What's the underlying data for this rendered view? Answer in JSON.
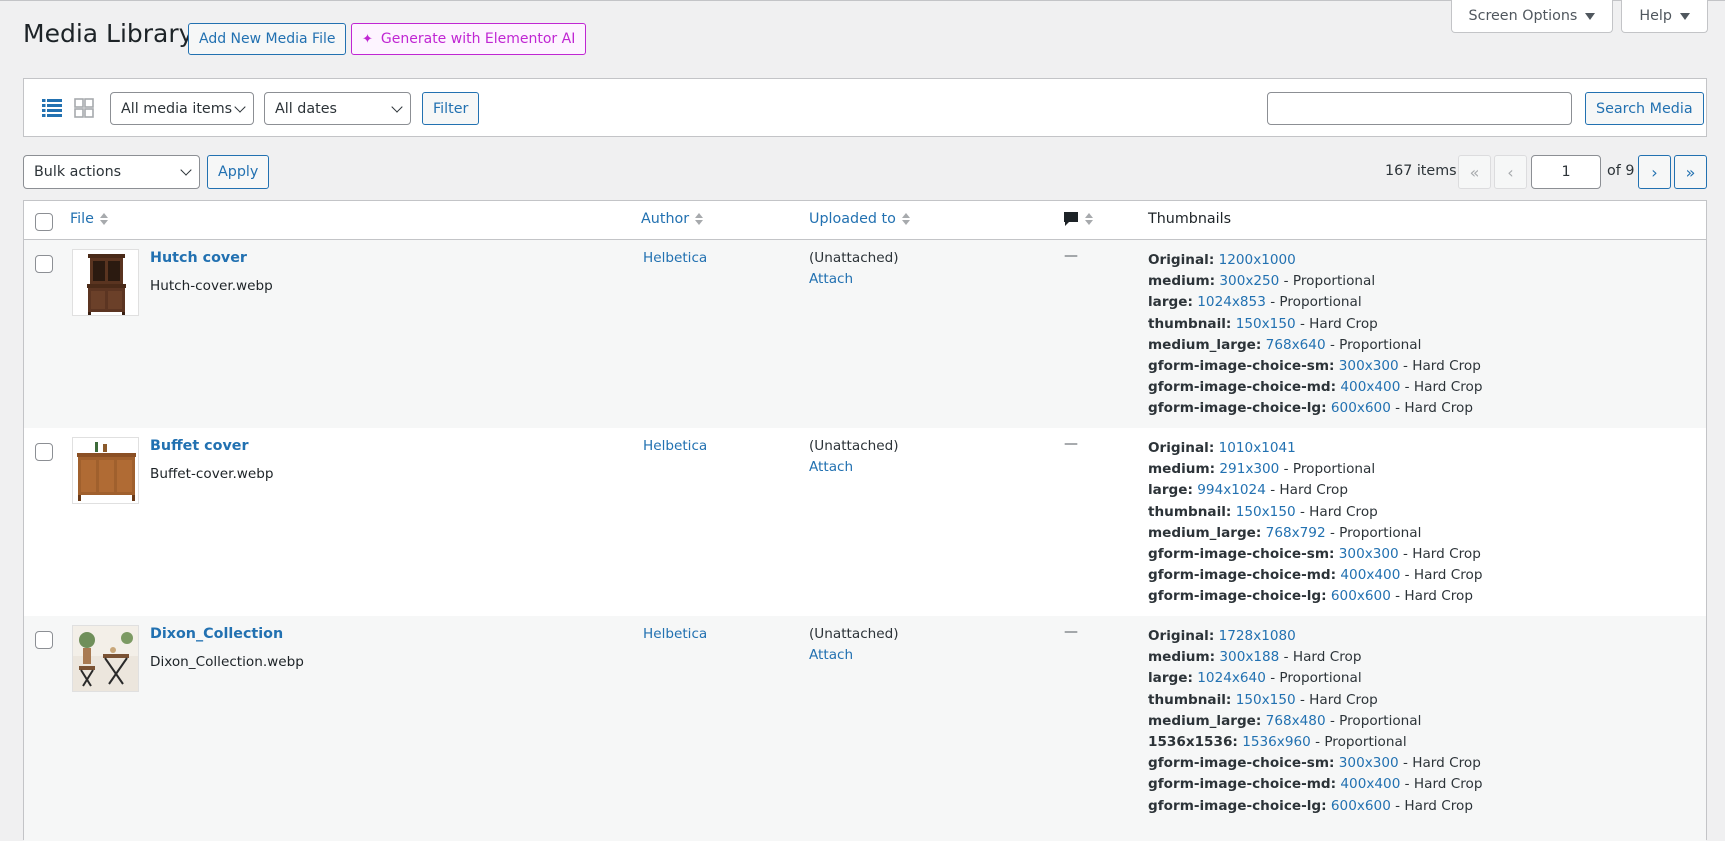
{
  "header": {
    "title": "Media Library",
    "add_new": "Add New Media File",
    "ai_button": "Generate with Elementor AI",
    "screen_options": "Screen Options",
    "help": "Help"
  },
  "filters": {
    "media_type": "All media items",
    "dates": "All dates",
    "filter_button": "Filter",
    "search_placeholder": "",
    "search_button": "Search Media"
  },
  "bulk": {
    "label": "Bulk actions",
    "apply": "Apply"
  },
  "pagination": {
    "items_count": "167 items",
    "first": "«",
    "prev": "‹",
    "current_page": "1",
    "of_text": "of 9",
    "next": "›",
    "last": "»"
  },
  "table": {
    "columns": {
      "file": "File",
      "author": "Author",
      "uploaded_to": "Uploaded to",
      "thumbnails": "Thumbnails"
    },
    "rows": [
      {
        "title": "Hutch cover",
        "filename": "Hutch-cover.webp",
        "author": "Helbetica",
        "uploaded_to": "(Unattached)",
        "attach": "Attach",
        "comments": "—",
        "thumbnails": [
          {
            "name": "Original:",
            "dims": "1200x1000",
            "type": ""
          },
          {
            "name": "medium:",
            "dims": "300x250",
            "type": "- Proportional"
          },
          {
            "name": "large:",
            "dims": "1024x853",
            "type": "- Proportional"
          },
          {
            "name": "thumbnail:",
            "dims": "150x150",
            "type": "- Hard Crop"
          },
          {
            "name": "medium_large:",
            "dims": "768x640",
            "type": "- Proportional"
          },
          {
            "name": "gform-image-choice-sm:",
            "dims": "300x300",
            "type": "- Hard Crop"
          },
          {
            "name": "gform-image-choice-md:",
            "dims": "400x400",
            "type": "- Hard Crop"
          },
          {
            "name": "gform-image-choice-lg:",
            "dims": "600x600",
            "type": "- Hard Crop"
          }
        ]
      },
      {
        "title": "Buffet cover",
        "filename": "Buffet-cover.webp",
        "author": "Helbetica",
        "uploaded_to": "(Unattached)",
        "attach": "Attach",
        "comments": "—",
        "thumbnails": [
          {
            "name": "Original:",
            "dims": "1010x1041",
            "type": ""
          },
          {
            "name": "medium:",
            "dims": "291x300",
            "type": "- Proportional"
          },
          {
            "name": "large:",
            "dims": "994x1024",
            "type": "- Hard Crop"
          },
          {
            "name": "thumbnail:",
            "dims": "150x150",
            "type": "- Hard Crop"
          },
          {
            "name": "medium_large:",
            "dims": "768x792",
            "type": "- Proportional"
          },
          {
            "name": "gform-image-choice-sm:",
            "dims": "300x300",
            "type": "- Hard Crop"
          },
          {
            "name": "gform-image-choice-md:",
            "dims": "400x400",
            "type": "- Hard Crop"
          },
          {
            "name": "gform-image-choice-lg:",
            "dims": "600x600",
            "type": "- Hard Crop"
          }
        ]
      },
      {
        "title": "Dixon_Collection",
        "filename": "Dixon_Collection.webp",
        "author": "Helbetica",
        "uploaded_to": "(Unattached)",
        "attach": "Attach",
        "comments": "—",
        "thumbnails": [
          {
            "name": "Original:",
            "dims": "1728x1080",
            "type": ""
          },
          {
            "name": "medium:",
            "dims": "300x188",
            "type": "- Hard Crop"
          },
          {
            "name": "large:",
            "dims": "1024x640",
            "type": "- Proportional"
          },
          {
            "name": "thumbnail:",
            "dims": "150x150",
            "type": "- Hard Crop"
          },
          {
            "name": "medium_large:",
            "dims": "768x480",
            "type": "- Proportional"
          },
          {
            "name": "1536x1536:",
            "dims": "1536x960",
            "type": "- Proportional"
          },
          {
            "name": "gform-image-choice-sm:",
            "dims": "300x300",
            "type": "- Hard Crop"
          },
          {
            "name": "gform-image-choice-md:",
            "dims": "400x400",
            "type": "- Hard Crop"
          },
          {
            "name": "gform-image-choice-lg:",
            "dims": "600x600",
            "type": "- Hard Crop"
          }
        ]
      }
    ]
  }
}
